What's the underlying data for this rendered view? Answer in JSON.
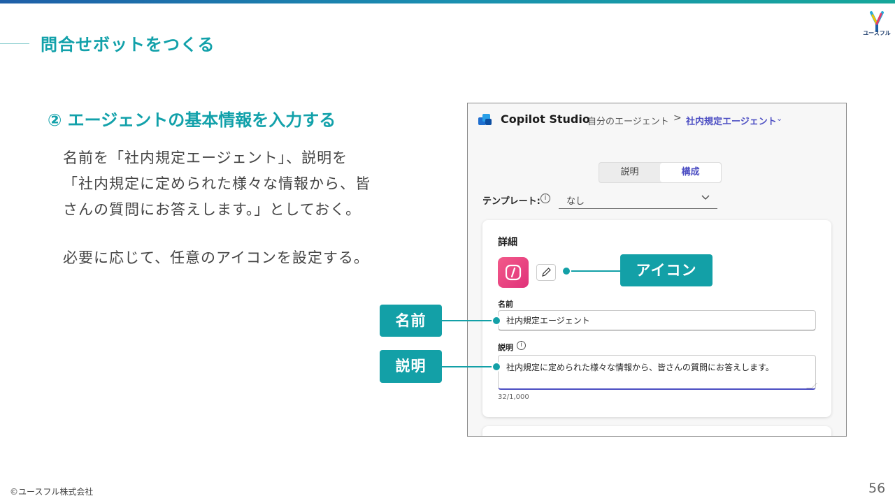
{
  "slide": {
    "title": "問合せボットをつくる",
    "logo_text": "ユースフル",
    "step_heading": "② エージェントの基本情報を入力する",
    "body_lines": [
      "名前を「社内規定エージェント」、説明を",
      "「社内規定に定められた様々な情報から、皆",
      "さんの質問にお答えします。」としておく。"
    ],
    "body_note": "必要に応じて、任意のアイコンを設定する。",
    "footer_copyright": "©ユースフル株式会社",
    "page_number": "56"
  },
  "screenshot": {
    "app_name": "Copilot Studio",
    "breadcrumb": {
      "parent": "自分のエージェント",
      "separator": ">",
      "current": "社内規定エージェント",
      "chevron": "⌄"
    },
    "tabs": [
      "説明",
      "構成"
    ],
    "active_tab": "構成",
    "template": {
      "label": "テンプレート:",
      "value": "なし"
    },
    "details": {
      "title": "詳細",
      "name_label": "名前",
      "name_value": "社内規定エージェント",
      "description_label": "説明",
      "description_value": "社内規定に定められた様々な情報から、皆さんの質問にお答えします。",
      "char_count": "32/1,000"
    }
  },
  "callouts": {
    "icon": "アイコン",
    "name": "名前",
    "description": "説明"
  },
  "colors": {
    "accent": "#13a0a7",
    "link_purple": "#4d4fc3",
    "agent_icon_pink": "#e8407f"
  },
  "icons": [
    "copilot-studio-logo-icon",
    "chevron-right-icon",
    "chevron-down-icon",
    "info-icon",
    "agent-code-icon",
    "pencil-icon",
    "usefull-logo-icon"
  ]
}
